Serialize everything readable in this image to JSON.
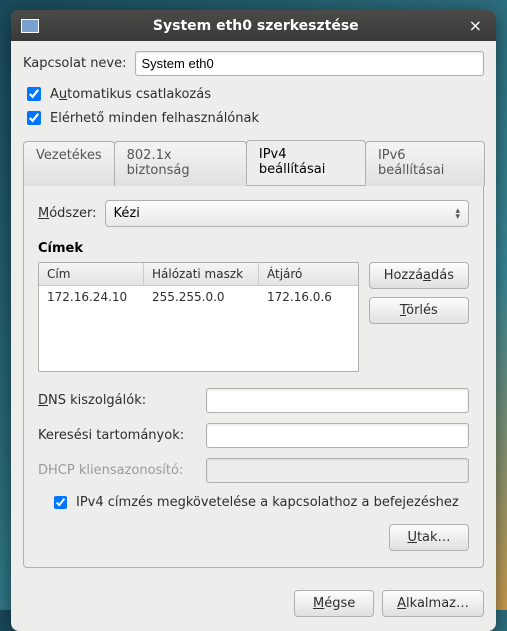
{
  "window": {
    "title": "System eth0 szerkesztése"
  },
  "connection": {
    "name_label": "Kapcsolat neve:",
    "name_value": "System eth0",
    "auto_label_pre": "A",
    "auto_label_u": "u",
    "auto_label_post": "tomatikus csatlakozás",
    "avail_label": "Elérhető minden felhasználónak"
  },
  "tabs": {
    "wired": "Vezetékes",
    "security": "802.1x biztonság",
    "ipv4": "IPv4 beállításai",
    "ipv6": "IPv6 beállításai"
  },
  "ipv4": {
    "method_label_pre": "",
    "method_label_u": "M",
    "method_label_post": "ódszer:",
    "method_value": "Kézi",
    "addresses_label": "Címek",
    "headers": {
      "address": "Cím",
      "netmask": "Hálózati maszk",
      "gateway": "Átjáró"
    },
    "rows": [
      {
        "address": "172.16.24.10",
        "netmask": "255.255.0.0",
        "gateway": "172.16.0.6"
      }
    ],
    "add_pre": "Hozzá",
    "add_u": "a",
    "add_post": "dás",
    "del_pre": "",
    "del_u": "T",
    "del_post": "örlés",
    "dns_pre": "",
    "dns_u": "D",
    "dns_post": "NS kiszolgálók:",
    "dns_value": "",
    "search_label": "Keresési tartományok:",
    "search_value": "",
    "dhcp_label": "DHCP kliensazonosító:",
    "dhcp_value": "",
    "require_label": "IPv4 címzés megkövetelése a kapcsolathoz a befejezéshez",
    "routes_pre": "",
    "routes_u": "U",
    "routes_post": "tak…"
  },
  "footer": {
    "cancel_pre": "",
    "cancel_u": "M",
    "cancel_post": "égse",
    "apply_pre": "",
    "apply_u": "A",
    "apply_post": "lkalmaz…"
  }
}
